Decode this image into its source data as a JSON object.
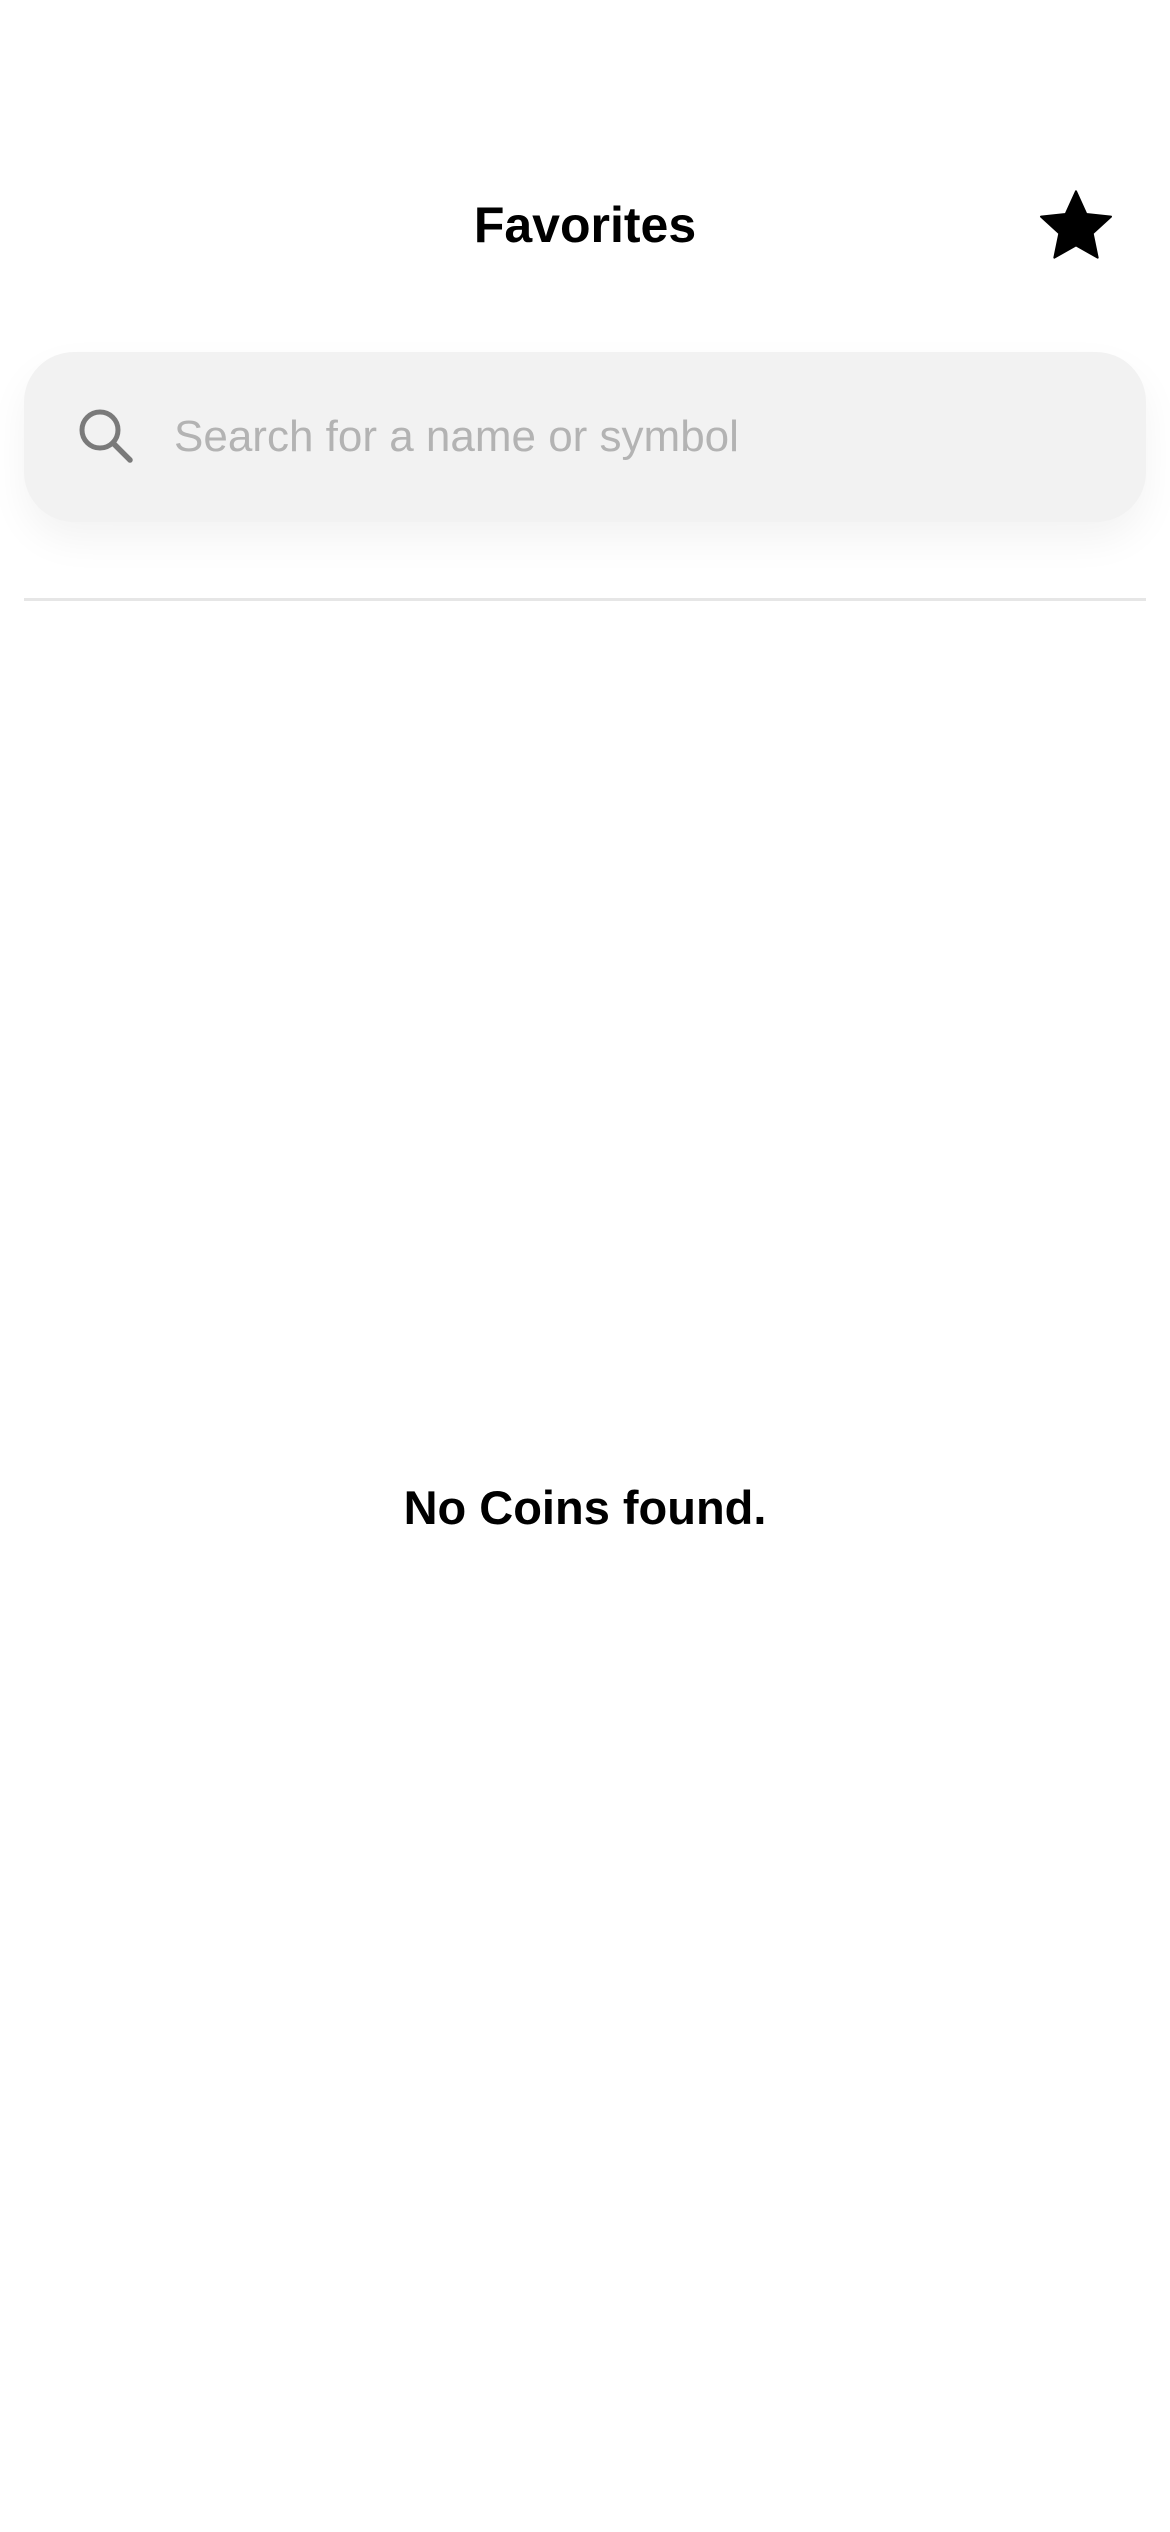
{
  "header": {
    "title": "Favorites",
    "favorites_icon": "star-icon"
  },
  "search": {
    "icon": "search-icon",
    "placeholder": "Search for a name or symbol",
    "value": ""
  },
  "empty_state": {
    "message": "No Coins found."
  },
  "colors": {
    "background": "#ffffff",
    "search_background": "#f2f2f2",
    "placeholder": "#b3b3b3",
    "text": "#000000",
    "divider": "#e6e6e6"
  }
}
